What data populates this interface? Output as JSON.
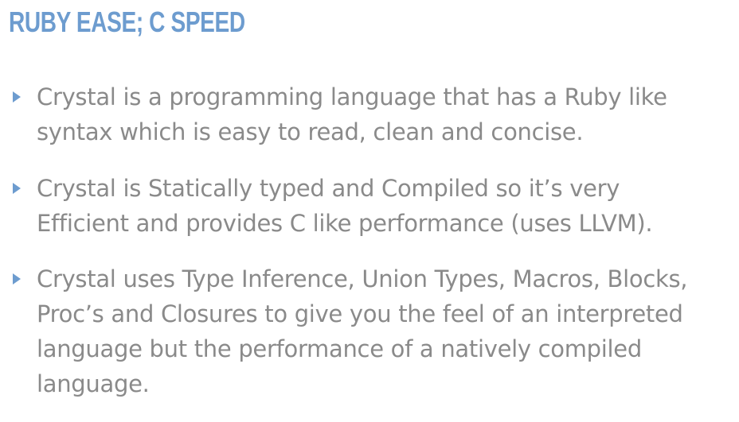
{
  "colors": {
    "title": "#6d9ccf",
    "text": "#8a8a8a",
    "bullet_marker": "#6d9ccf",
    "background": "#ffffff"
  },
  "slide": {
    "title": "RUBY EASE; C SPEED",
    "bullet_icon": "triangle-right-icon",
    "bullets": [
      {
        "lines": [
          "Crystal is a programming language that has a Ruby like",
          "syntax which is easy to read, clean and concise."
        ]
      },
      {
        "lines": [
          "Crystal is Statically typed and Compiled so it’s very",
          "Efficient and provides C like performance (uses LLVM)."
        ]
      },
      {
        "lines": [
          "Crystal uses Type Inference, Union Types, Macros, Blocks,",
          "Proc’s and Closures to give you the feel of an interpreted",
          "language but the performance of a natively compiled",
          "language."
        ]
      }
    ]
  }
}
